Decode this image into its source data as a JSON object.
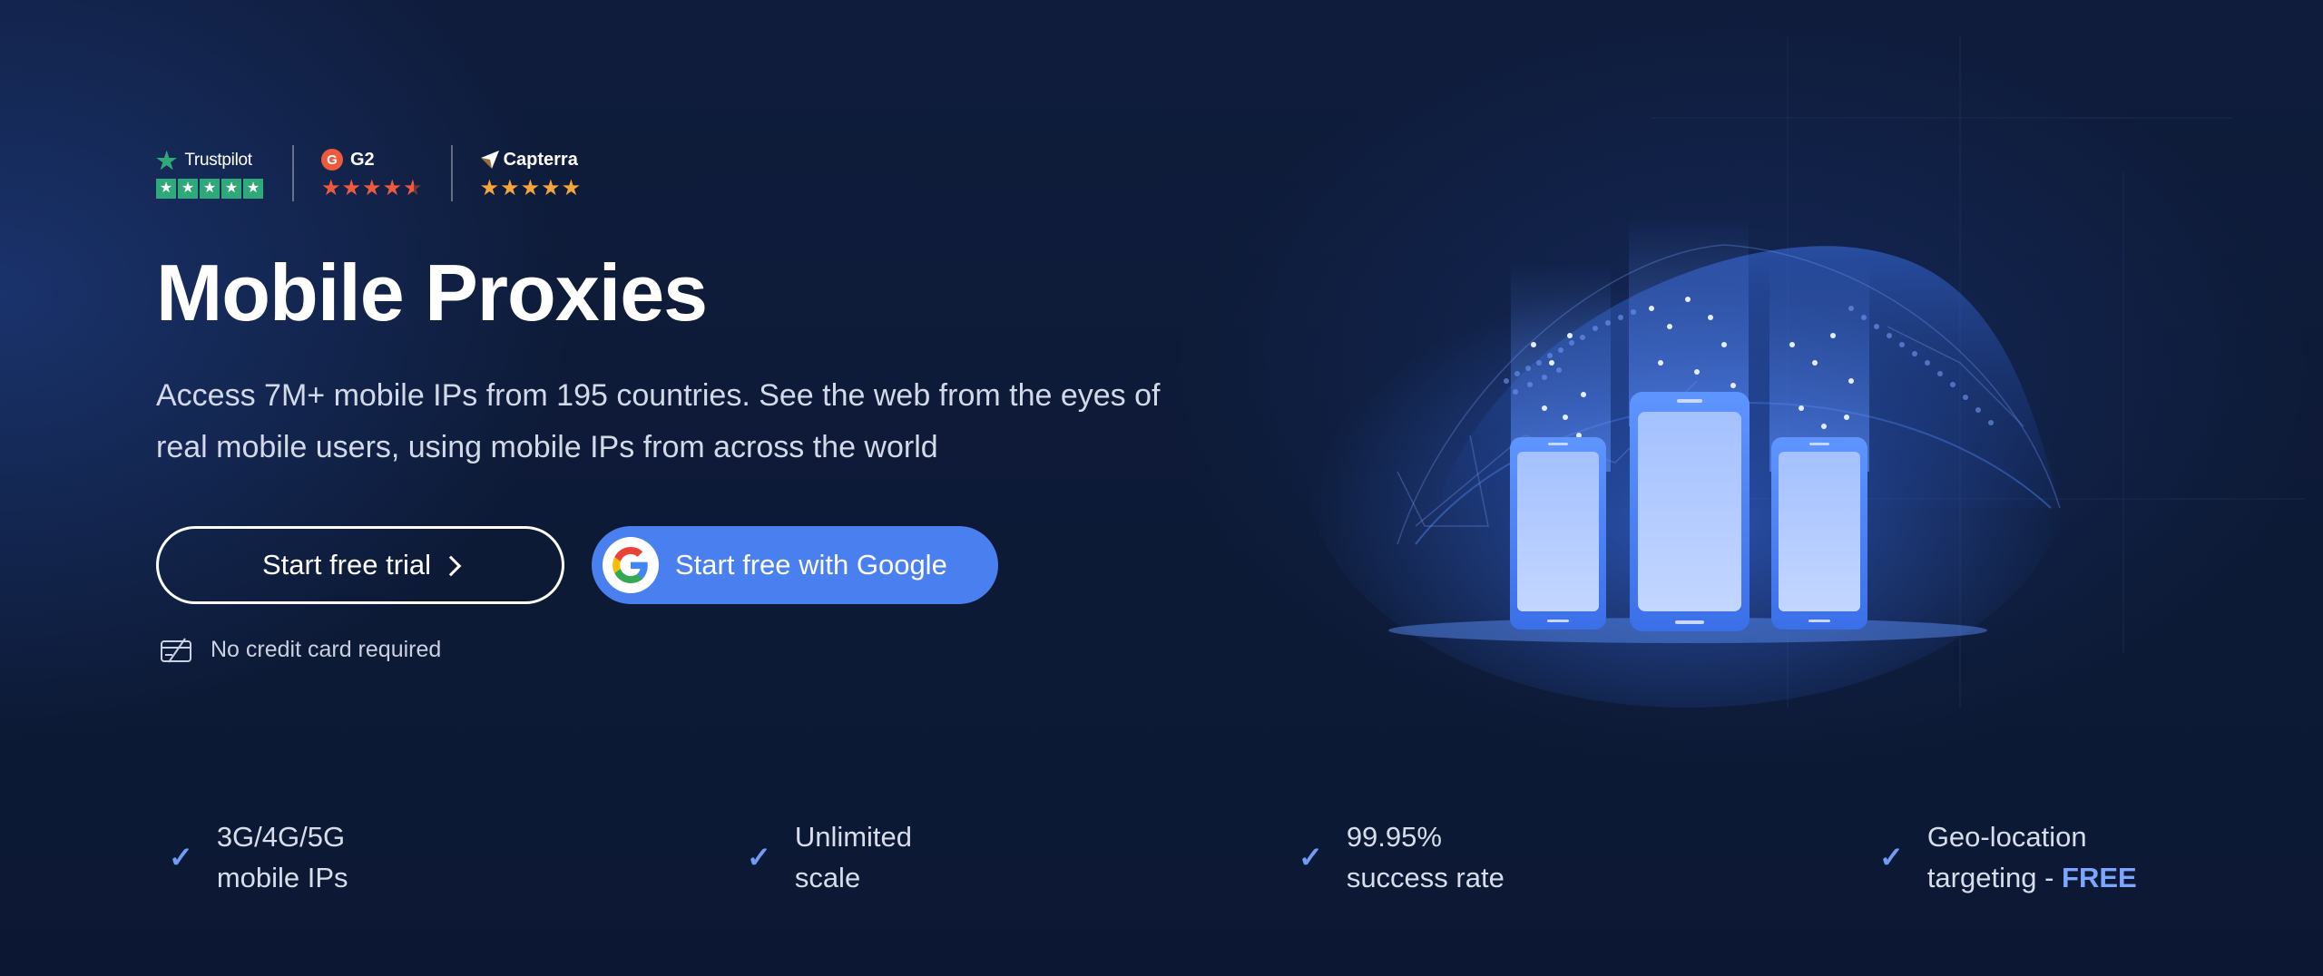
{
  "ratings": {
    "trustpilot": {
      "name": "Trustpilot",
      "stars": 5,
      "color": "#2fa979"
    },
    "g2": {
      "name": "G2",
      "badge": "G",
      "stars": 4.5,
      "color": "#f05a3c"
    },
    "capterra": {
      "name": "Capterra",
      "stars": 5,
      "color": "#f6a53a"
    }
  },
  "hero": {
    "title": "Mobile Proxies",
    "description": "Access 7M+ mobile IPs from 195 countries. See the web from the eyes of real mobile users, using mobile IPs from across the world",
    "trial_label": "Start free trial",
    "google_label": "Start free with Google",
    "no_card_label": "No credit card required"
  },
  "features": [
    {
      "line1": "3G/4G/5G",
      "line2": "mobile IPs"
    },
    {
      "line1": "Unlimited",
      "line2": "scale"
    },
    {
      "line1": "99.95%",
      "line2": "success rate"
    },
    {
      "line1": "Geo-location",
      "line2": "targeting -",
      "highlight": "FREE"
    }
  ],
  "colors": {
    "accent": "#4a7ff0",
    "check": "#6f9cf5",
    "background": "#0f1c3c"
  }
}
